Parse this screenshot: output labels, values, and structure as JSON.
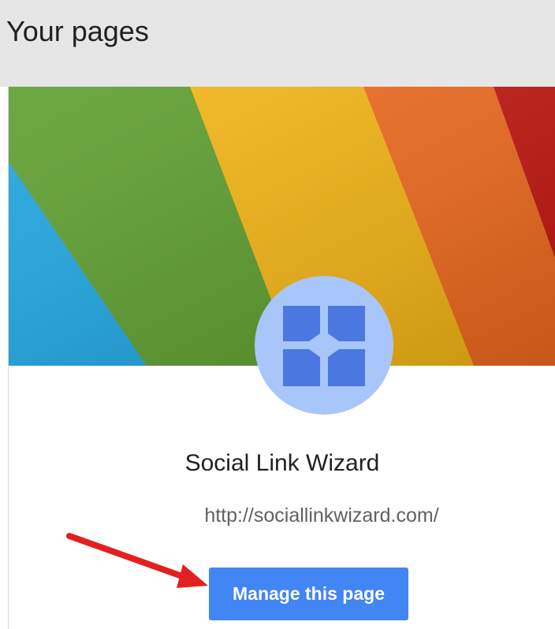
{
  "section": {
    "title": "Your pages"
  },
  "page": {
    "name": "Social Link Wizard",
    "url": "http://sociallinkwizard.com/",
    "manage_label": "Manage this page",
    "avatar_icon": "puzzle-tiles-icon",
    "cover": "rainbow-fabric-photo"
  },
  "colors": {
    "header_bg": "#e6e6e6",
    "button_bg": "#4285f4",
    "avatar_bg": "#a8c6fa",
    "avatar_tiles": "#4a78e0",
    "annotation_arrow": "#e32020"
  }
}
